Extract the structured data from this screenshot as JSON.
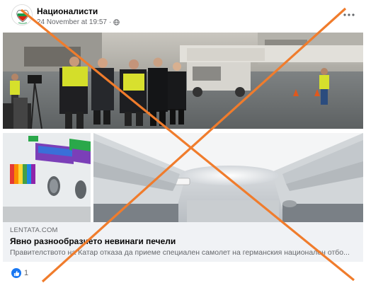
{
  "post": {
    "page_name": "Националисти",
    "timestamp": "24 November at 19:57",
    "separator": "·",
    "privacy_icon": "globe-icon",
    "more_icon": "more-options-icon"
  },
  "link": {
    "source": "LENTATA.COM",
    "title": "Явно разнообразието невинаги печели",
    "description": "Правителството на Катар отказа да приеме специален самолет на германския национален отбо..."
  },
  "reactions": {
    "icon": "like-icon",
    "count": "1"
  },
  "colors": {
    "accent": "#1877f2",
    "overlay_cross": "#f07c2c",
    "secondary_text": "#65676b",
    "preview_bg": "#f0f2f5"
  }
}
